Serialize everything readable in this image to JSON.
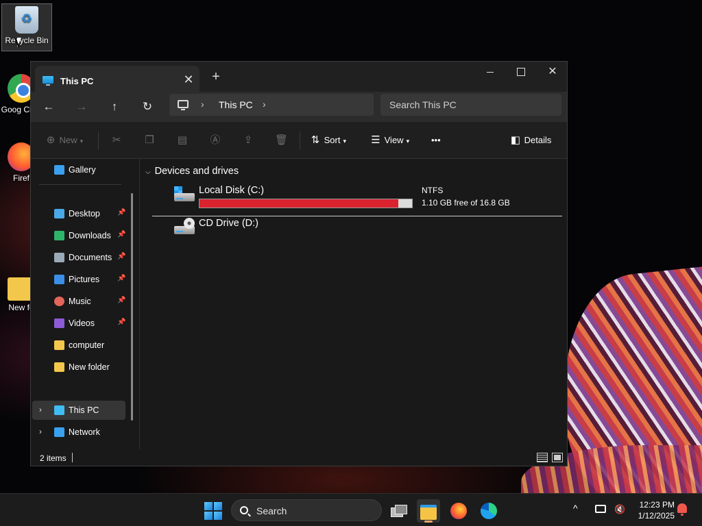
{
  "desktop": {
    "icons": [
      {
        "label": "Recycle Bin"
      },
      {
        "label": "Goog Chro"
      },
      {
        "label": "Firef"
      },
      {
        "label": "New fo"
      }
    ]
  },
  "window": {
    "tab_title": "This PC",
    "tab_close_glyph": "✕",
    "new_tab_glyph": "+",
    "close_glyph": "✕"
  },
  "nav": {
    "back_glyph": "←",
    "forward_glyph": "→",
    "up_glyph": "↑",
    "refresh_glyph": "↻",
    "breadcrumb": [
      "This PC"
    ],
    "chevron_glyph": "›",
    "search_placeholder": "Search This PC"
  },
  "toolbar": {
    "new_label": "New",
    "sort_label": "Sort",
    "view_label": "View",
    "more_glyph": "•••",
    "details_label": "Details"
  },
  "sidebar": {
    "items": [
      {
        "label": "Gallery",
        "color": "#3aa0f0"
      },
      {
        "label": "Desktop",
        "color": "#4aa8e8",
        "pinned": true
      },
      {
        "label": "Downloads",
        "color": "#2fb56a",
        "pinned": true
      },
      {
        "label": "Documents",
        "color": "#9aa9b8",
        "pinned": true
      },
      {
        "label": "Pictures",
        "color": "#3a8ee6",
        "pinned": true
      },
      {
        "label": "Music",
        "color": "#e2665a",
        "pinned": true
      },
      {
        "label": "Videos",
        "color": "#8d5bd8",
        "pinned": true
      },
      {
        "label": "computer",
        "color": "#f2c74b"
      },
      {
        "label": "New folder",
        "color": "#f2c74b"
      },
      {
        "label": "This PC",
        "color": "#3fbdf2",
        "selected": true
      },
      {
        "label": "Network",
        "color": "#3aa0f0"
      }
    ],
    "pin_glyph": "📌",
    "expand_glyph": "›"
  },
  "content": {
    "group_title": "Devices and drives",
    "group_chevron": "⌵",
    "drives": [
      {
        "name": "Local Disk (C:)",
        "filesystem": "NTFS",
        "free_text": "1.10 GB free of 16.8 GB",
        "used_fraction": 0.935,
        "bar_color": "#d9232f"
      },
      {
        "name": "CD Drive (D:)"
      }
    ]
  },
  "status": {
    "item_count": "2 items"
  },
  "taskbar": {
    "search_label": "Search",
    "tray_chevron": "^",
    "time": "12:23 PM",
    "date": "1/12/2025"
  }
}
